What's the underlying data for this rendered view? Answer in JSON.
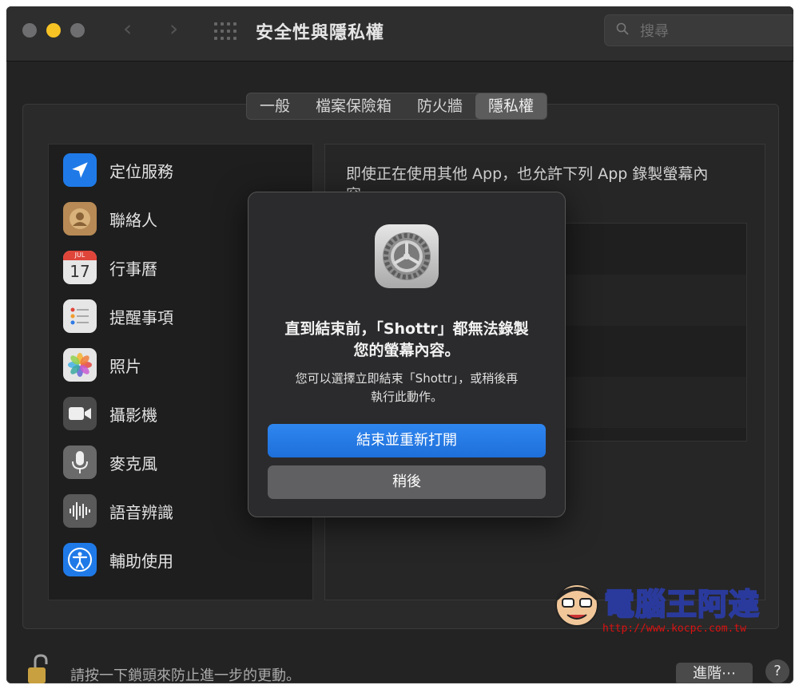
{
  "window": {
    "title": "安全性與隱私權",
    "search_placeholder": "搜尋"
  },
  "tabs": [
    {
      "label": "一般",
      "active": false
    },
    {
      "label": "檔案保險箱",
      "active": false
    },
    {
      "label": "防火牆",
      "active": false
    },
    {
      "label": "隱私權",
      "active": true
    }
  ],
  "sidebar": {
    "items": [
      {
        "label": "定位服務",
        "icon": "location-arrow-icon",
        "color": "#1f7ae8"
      },
      {
        "label": "聯絡人",
        "icon": "contacts-icon",
        "color": "#b88a55"
      },
      {
        "label": "行事曆",
        "icon": "calendar-icon",
        "color": "#e6e6e6",
        "calendar_month": "JUL",
        "calendar_day": "17"
      },
      {
        "label": "提醒事項",
        "icon": "reminders-icon",
        "color": "#e6e6e6"
      },
      {
        "label": "照片",
        "icon": "photos-icon",
        "color": "#e6e6e6"
      },
      {
        "label": "攝影機",
        "icon": "camera-icon",
        "color": "#4a4a4a"
      },
      {
        "label": "麥克風",
        "icon": "microphone-icon",
        "color": "#6a6a6a"
      },
      {
        "label": "語音辨識",
        "icon": "speech-recognition-icon",
        "color": "#5a5a5a"
      },
      {
        "label": "輔助使用",
        "icon": "accessibility-icon",
        "color": "#1f7ae8"
      }
    ]
  },
  "main": {
    "description": "即使正在使用其他 App，也允許下列 App 錄製螢幕內容。"
  },
  "dialog": {
    "title_line1": "直到結束前，「Shottr」都無法錄製",
    "title_line2": "您的螢幕內容。",
    "message_line1": "您可以選擇立即結束「Shottr」，或稍後再",
    "message_line2": "執行此動作。",
    "primary_button": "結束並重新打開",
    "secondary_button": "稍後"
  },
  "bottom_bar": {
    "lock_text": "請按一下鎖頭來防止進一步的更動。",
    "advanced_button": "進階⋯",
    "help_button": "?"
  },
  "watermark": {
    "text": "電腦王阿達",
    "url": "http://www.kocpc.com.tw"
  }
}
